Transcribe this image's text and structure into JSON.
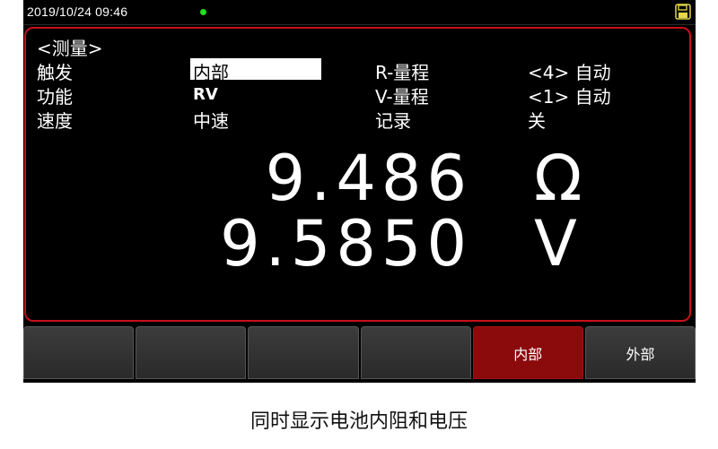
{
  "status_bar": {
    "datetime": "2019/10/24  09:46",
    "indicator_color": "#22dd22",
    "icon": "save-icon"
  },
  "panel": {
    "title": "<测量>",
    "rows": [
      {
        "label": "触发",
        "value": "内部",
        "param_label": "R-量程",
        "param_value": "<4> 自动"
      },
      {
        "label": "功能",
        "value": "RV",
        "param_label": "V-量程",
        "param_value": "<1> 自动"
      },
      {
        "label": "速度",
        "value": "中速",
        "param_label": "记录",
        "param_value": "关"
      }
    ],
    "resistance_value": "9.486",
    "resistance_unit": "Ω",
    "voltage_value": "9.5850",
    "voltage_unit": "V",
    "border_color": "#c8101a"
  },
  "softkeys": [
    {
      "label": ""
    },
    {
      "label": ""
    },
    {
      "label": ""
    },
    {
      "label": ""
    },
    {
      "label": "内部",
      "active": true
    },
    {
      "label": "外部"
    }
  ],
  "softkey_active_color": "#8b0a0c",
  "caption": "同时显示电池内阻和电压"
}
